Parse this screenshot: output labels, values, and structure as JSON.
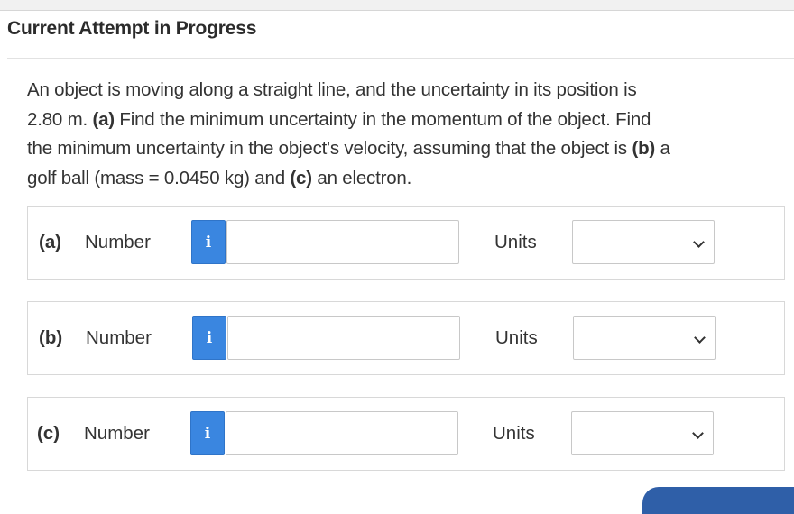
{
  "heading": "Current Attempt in Progress",
  "question": {
    "line1": "An object is moving along a straight line, and the uncertainty in its position is",
    "line2_a": "2.80 m. ",
    "line2_b": "(a)",
    "line2_c": " Find the minimum uncertainty in the momentum of the object. Find",
    "line3_a": "the minimum uncertainty in the object's velocity, assuming that the object is ",
    "line3_b": "(b)",
    "line3_c": " a",
    "line4_a": "golf ball (mass = 0.0450 kg) and ",
    "line4_b": "(c)",
    "line4_c": " an electron."
  },
  "parts": [
    {
      "part": "(a)",
      "number_label": "Number",
      "info_icon": "i",
      "number_value": "",
      "units_label": "Units",
      "units_value": ""
    },
    {
      "part": "(b)",
      "number_label": "Number",
      "info_icon": "i",
      "number_value": "",
      "units_label": "Units",
      "units_value": ""
    },
    {
      "part": "(c)",
      "number_label": "Number",
      "info_icon": "i",
      "number_value": "",
      "units_label": "Units",
      "units_value": ""
    }
  ],
  "colors": {
    "info_button": "#3a86e0",
    "submit_button": "#2f5fa8"
  }
}
